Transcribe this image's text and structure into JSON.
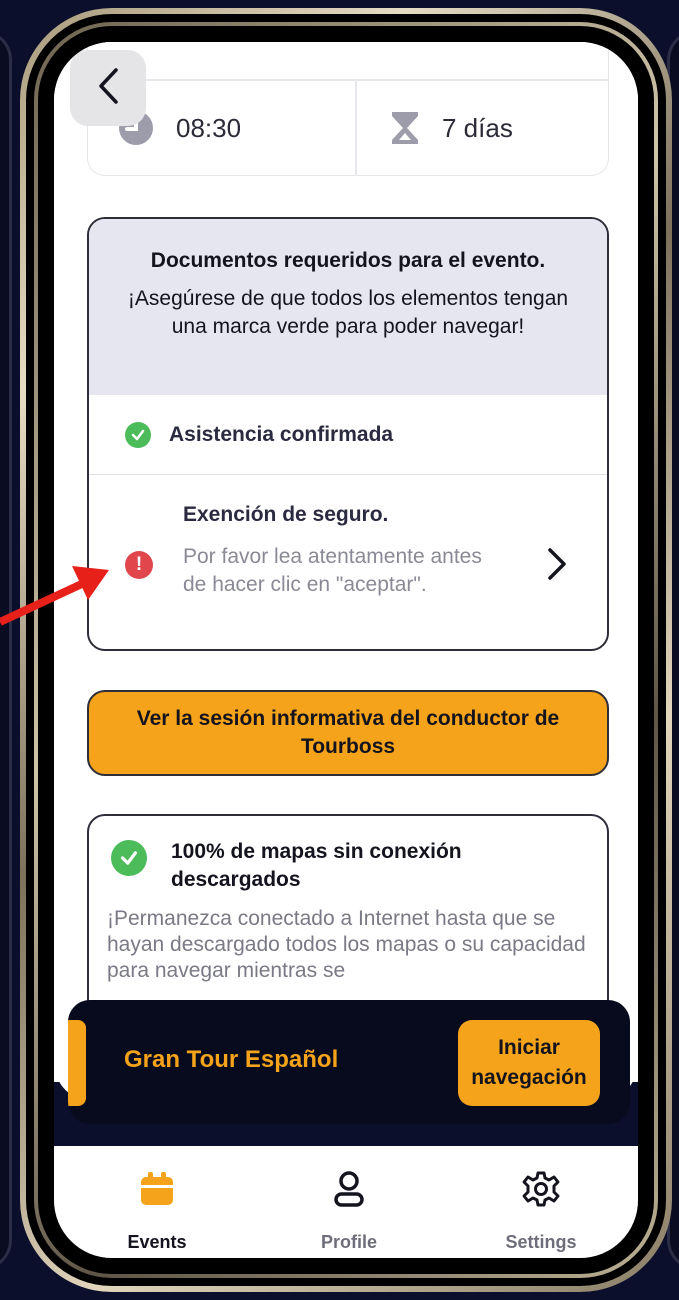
{
  "event_info": {
    "time": "08:30",
    "duration": "7 días"
  },
  "documents": {
    "title": "Documentos requeridos para el evento.",
    "subtitle": "¡Asegúrese de que todos los elementos tengan una marca verde para poder navegar!",
    "items": [
      {
        "label": "Asistencia confirmada",
        "status": "complete"
      },
      {
        "label": "Exención de seguro.",
        "description": "Por favor lea atentamente antes de hacer clic en \"aceptar\".",
        "status": "pending"
      }
    ]
  },
  "briefing_button": {
    "label": "Ver la sesión informativa del conductor de Tourboss"
  },
  "offline_maps": {
    "title": "100% de mapas sin conexión descargados",
    "text": "¡Permanezca conectado a Internet hasta que se hayan descargado todos los mapas o su capacidad para navegar mientras se"
  },
  "tour_bar": {
    "tour_name": "Gran Tour Español",
    "start_button": "Iniciar navegación"
  },
  "tabs": [
    {
      "label": "Events",
      "icon": "calendar-icon",
      "active": true
    },
    {
      "label": "Profile",
      "icon": "user-icon",
      "active": false
    },
    {
      "label": "Settings",
      "icon": "gear-icon",
      "active": false
    }
  ],
  "colors": {
    "accent": "#f5a31a",
    "success": "#4cbb5a",
    "warning": "#e0464b",
    "dark": "#0c0f2c",
    "annotation_arrow": "#e8201a"
  }
}
